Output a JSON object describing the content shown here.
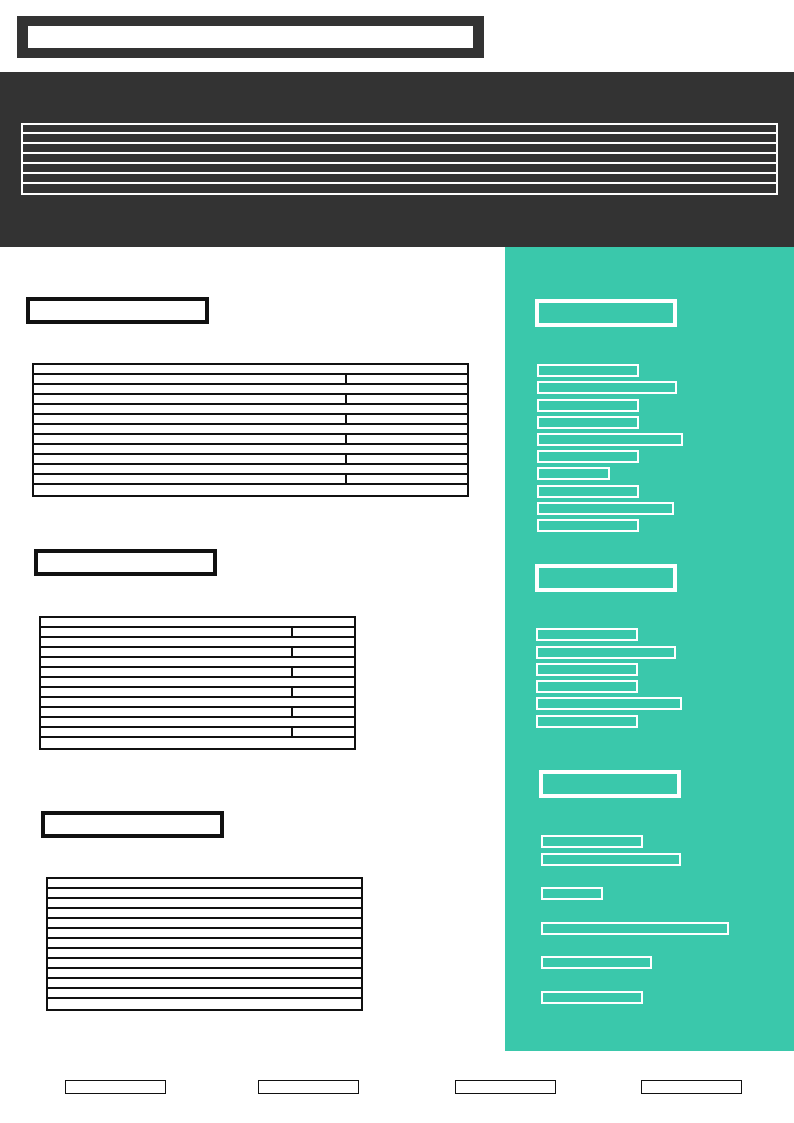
{
  "colors": {
    "header_band": "#333333",
    "sidebar": "#3ac8ab",
    "placeholder_stroke": "#111111",
    "placeholder_fill": "#ffffff"
  },
  "content_note": ""
}
